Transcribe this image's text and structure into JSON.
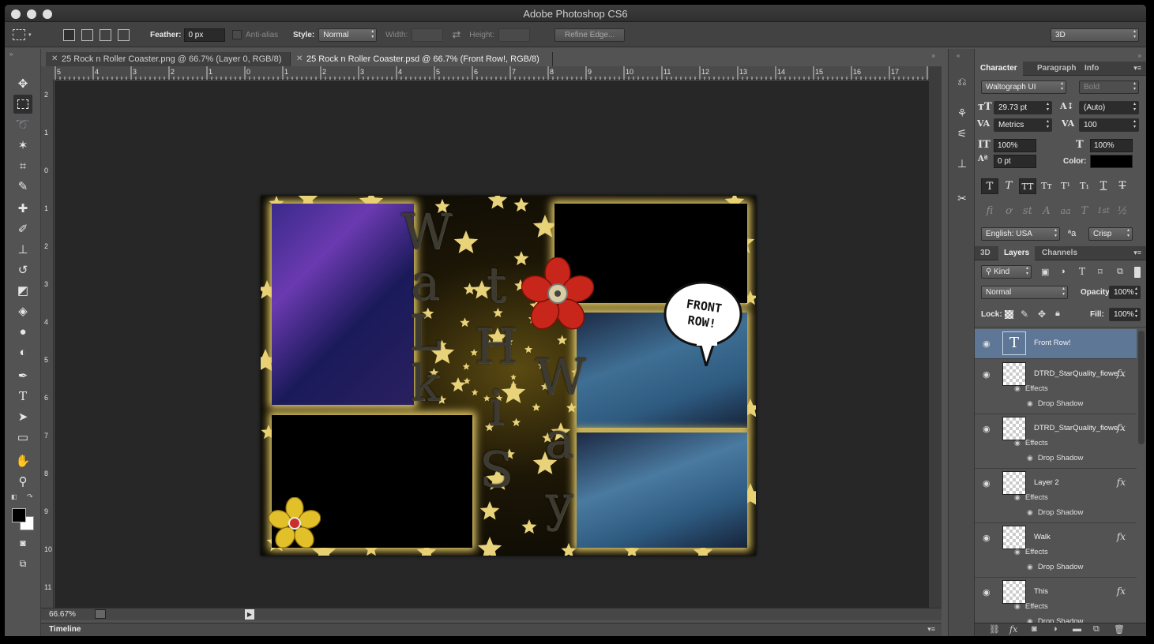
{
  "app_title": "Adobe Photoshop CS6",
  "options_bar": {
    "feather_label": "Feather:",
    "feather_value": "0 px",
    "antialias_label": "Anti-alias",
    "style_label": "Style:",
    "style_value": "Normal",
    "width_label": "Width:",
    "height_label": "Height:",
    "refine_edge_label": "Refine Edge...",
    "workspace_value": "3D"
  },
  "tabs": [
    {
      "label": "25 Rock n Roller Coaster.png @ 66.7% (Layer 0, RGB/8)",
      "active": false
    },
    {
      "label": "25 Rock n Roller Coaster.psd @ 66.7% (Front Row!, RGB/8)",
      "active": true
    }
  ],
  "ruler": {
    "top": [
      "5",
      "4",
      "3",
      "2",
      "1",
      "0",
      "1",
      "2",
      "3",
      "4",
      "5",
      "6",
      "7",
      "8",
      "9",
      "10",
      "11",
      "12",
      "13",
      "14",
      "15",
      "16",
      "17"
    ],
    "left": [
      "2",
      "1",
      "0",
      "1",
      "2",
      "3",
      "4",
      "5",
      "6",
      "7",
      "8",
      "9",
      "10",
      "11"
    ]
  },
  "status": {
    "zoom": "66.67%"
  },
  "timeline_label": "Timeline",
  "artwork": {
    "speech_bubble": "FRONT ROW!",
    "title_letters_left": [
      "W",
      "a",
      "L",
      "k"
    ],
    "title_letters_mid": [
      "t",
      "H",
      "i",
      "S"
    ],
    "title_letters_right": [
      "W",
      "a",
      "y"
    ]
  },
  "character_panel": {
    "tabs": [
      "Character",
      "Paragraph",
      "Info"
    ],
    "font_family": "Waltograph UI",
    "font_style": "Bold",
    "font_size": "29.73 pt",
    "leading": "(Auto)",
    "kerning": "Metrics",
    "tracking": "100",
    "vertical_scale": "100%",
    "horizontal_scale": "100%",
    "baseline_shift": "0 pt",
    "color_label": "Color:",
    "color_value": "#000000",
    "type_buttons": [
      "T",
      "T",
      "TT",
      "Tт",
      "T¹",
      "T₁",
      "T",
      "T"
    ],
    "ot_buttons": [
      "fi",
      "ơ",
      "st",
      "A",
      "aa",
      "T",
      "1st",
      "½"
    ],
    "language": "English: USA",
    "antialias": "Crisp",
    "aa_glyph": "ªa"
  },
  "layers_panel": {
    "tabs": [
      "3D",
      "Layers",
      "Channels"
    ],
    "filter_kind": "Kind",
    "blend_mode": "Normal",
    "opacity_label": "Opacity:",
    "opacity": "100%",
    "lock_label": "Lock:",
    "fill_label": "Fill:",
    "fill": "100%",
    "effects_label": "Effects",
    "drop_shadow_label": "Drop Shadow",
    "layers": [
      {
        "name": "Front Row!",
        "type": "text",
        "selected": true,
        "fx": false
      },
      {
        "name": "DTRD_StarQuality_fiowe...",
        "type": "smart",
        "selected": false,
        "fx": true
      },
      {
        "name": "DTRD_StarQuality_fiowe...",
        "type": "smart",
        "selected": false,
        "fx": true
      },
      {
        "name": "Layer 2",
        "type": "pixel",
        "selected": false,
        "fx": true
      },
      {
        "name": "Walk",
        "type": "pixel",
        "selected": false,
        "fx": true
      },
      {
        "name": "This",
        "type": "pixel",
        "selected": false,
        "fx": true
      }
    ],
    "cut_off_row": "Drop Shadow"
  }
}
